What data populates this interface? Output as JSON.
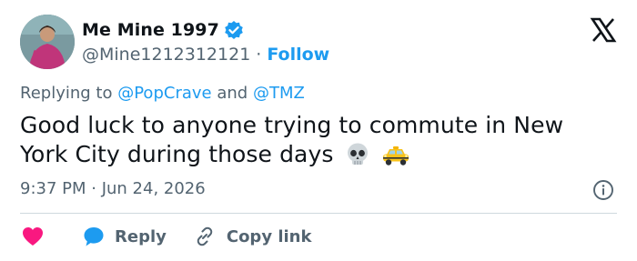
{
  "author": {
    "display_name": "Me Mine 1997",
    "handle": "@Mine1212312121",
    "separator": "·",
    "follow_label": "Follow"
  },
  "replying": {
    "prefix": "Replying to",
    "mention_1": "@PopCrave",
    "conjunction": "and",
    "mention_2": "@TMZ"
  },
  "tweet": {
    "text": "Good luck to anyone trying to commute in New York City during those days",
    "emojis": [
      "skull-emoji",
      "taxi-emoji"
    ],
    "timestamp": "9:37 PM · Jun 24, 2026"
  },
  "actions": {
    "reply_label": "Reply",
    "copy_link_label": "Copy link"
  },
  "colors": {
    "accent": "#1d9bf0",
    "heart": "#f91880",
    "text": "#0f1419",
    "muted": "#536471",
    "divider": "#cfd9de"
  }
}
